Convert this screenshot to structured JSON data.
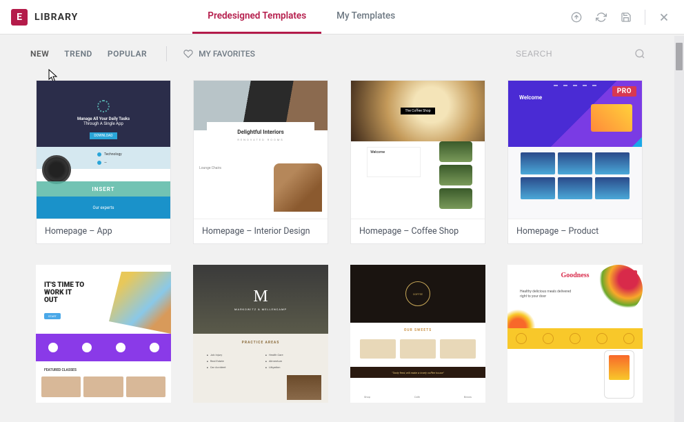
{
  "header": {
    "title": "LIBRARY",
    "logo_letter": "E"
  },
  "tabs": [
    {
      "label": "Predesigned Templates",
      "active": true
    },
    {
      "label": "My Templates",
      "active": false
    }
  ],
  "filters": {
    "items": [
      "NEW",
      "TREND",
      "POPULAR"
    ],
    "favorites_label": "MY FAVORITES"
  },
  "search": {
    "placeholder": "SEARCH"
  },
  "templates_row1": [
    {
      "title": "Homepage – App",
      "pro": false,
      "overlay": "INSERT",
      "bluebar": "Our experts",
      "hero_txt1": "Manage All Your Daily Tasks",
      "hero_txt2": "Through A Single App",
      "feature": "Technology"
    },
    {
      "title": "Homepage – Interior Design",
      "pro": true,
      "delightful": "Delightful Interiors",
      "sub": "RENOVATED ROOMS",
      "lounge": "Lounge Chairs"
    },
    {
      "title": "Homepage – Coffee Shop",
      "pro": true,
      "tag": "The Coffee Shop",
      "welcome": "Welcome"
    },
    {
      "title": "Homepage – Product",
      "pro": true,
      "welcome": "Welcome"
    }
  ],
  "templates_row2": [
    {
      "headline": "IT'S TIME TO WORK IT OUT",
      "featured": "FEATURED CLASSES",
      "pro": false
    },
    {
      "m": "M",
      "firm": "MARKOWITZ & MELLENCAMP",
      "practice": "PRACTICE AREAS",
      "areas": [
        "Job Injury",
        "Health Care",
        "Real Estate",
        "Alimentum",
        "Car Accident",
        "Litigation"
      ],
      "pro": false
    },
    {
      "sweets": "OUR SWEETS",
      "banner": "\"Tasty feed, will make a lovely coffee house\"",
      "pro": false
    },
    {
      "logo": "Goodness",
      "headline": "Healthy delicious meals delivered right to your door",
      "pro": true
    }
  ],
  "badges": {
    "pro": "PRO"
  }
}
